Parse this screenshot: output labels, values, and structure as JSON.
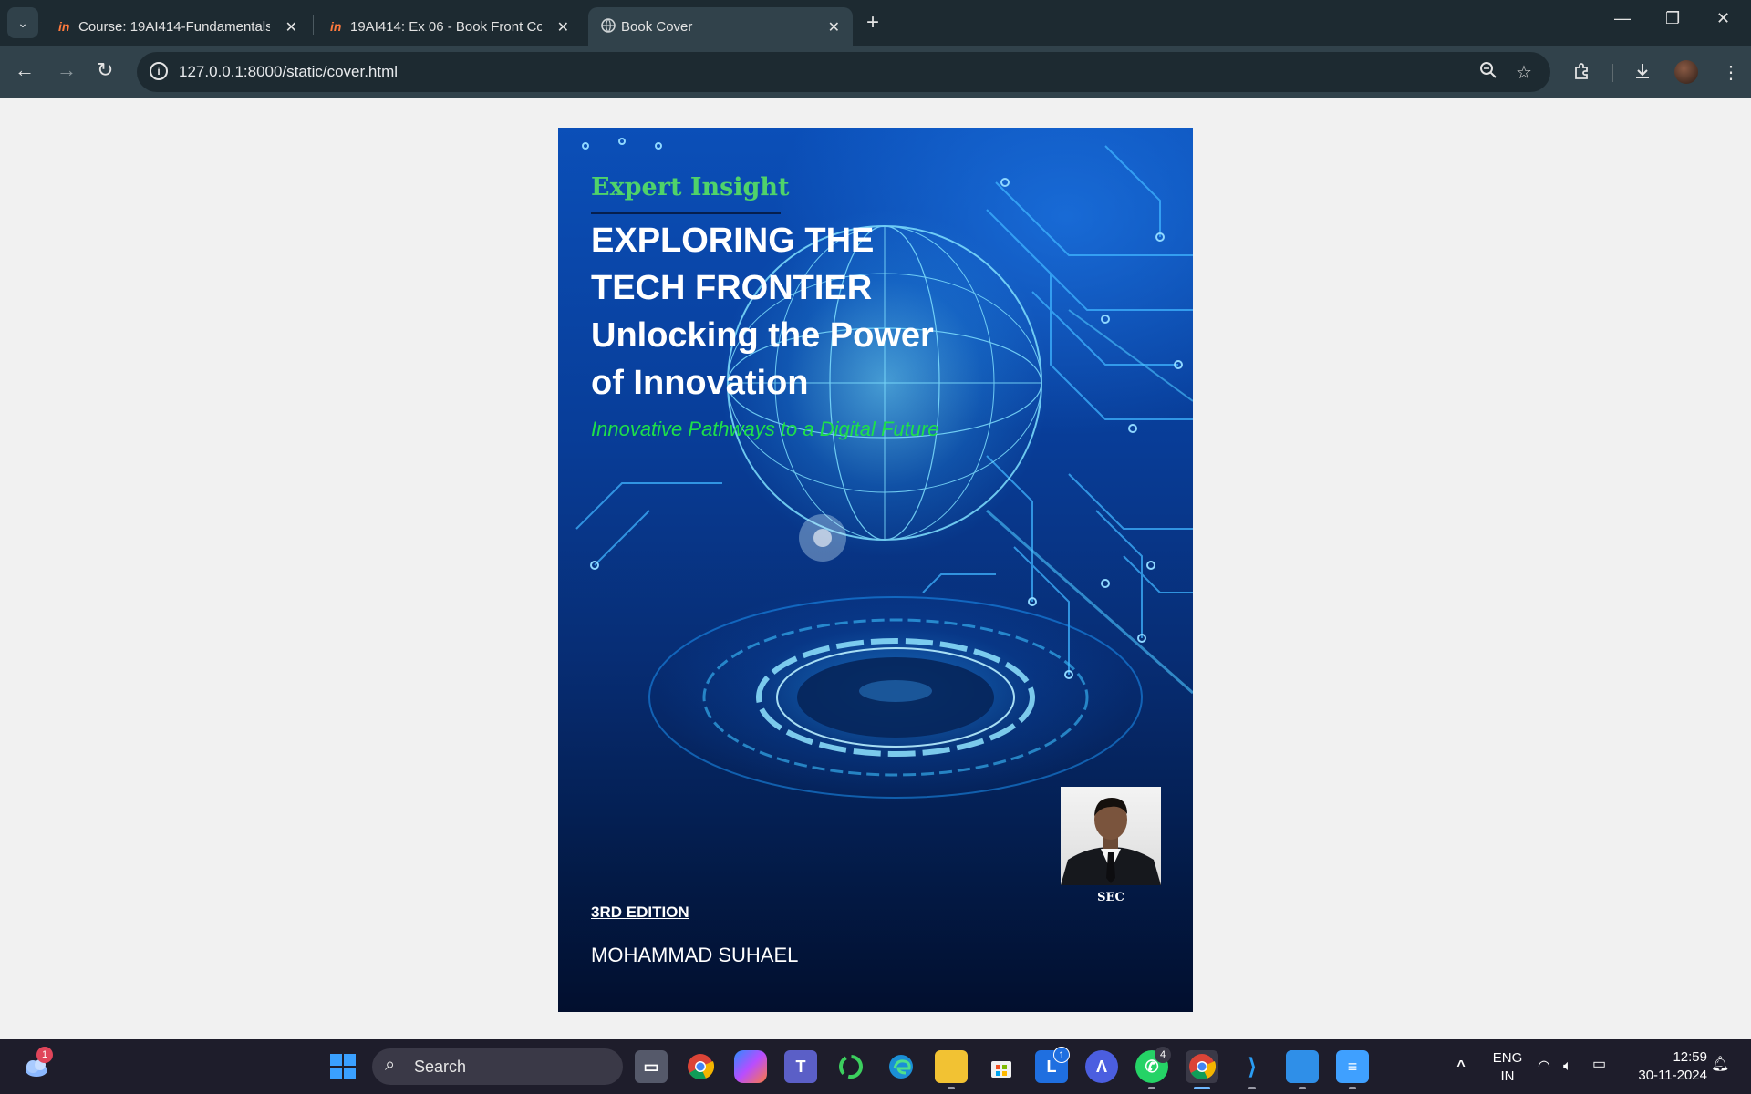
{
  "browser": {
    "tabs": [
      {
        "title": "Course: 19AI414-Fundamentals",
        "favicon": "in",
        "active": false
      },
      {
        "title": "19AI414: Ex 06 - Book Front Co",
        "favicon": "in",
        "active": false
      },
      {
        "title": "Book Cover",
        "favicon": "globe-icon",
        "active": true
      }
    ],
    "url": "127.0.0.1:8000/static/cover.html"
  },
  "cover": {
    "series": "Expert Insight",
    "title_line1": "EXPLORING THE",
    "title_line2": "TECH FRONTIER",
    "title_line3": "Unlocking the Power",
    "title_line4": "of Innovation",
    "tagline": "Innovative Pathways to a Digital Future",
    "photo_label": "SEC",
    "edition": "3RD EDITION",
    "author": "MOHAMMAD SUHAEL",
    "colors": {
      "series": "#4fd36a",
      "tagline": "#1ee04a",
      "title": "#ffffff"
    }
  },
  "taskbar": {
    "search_label": "Search",
    "widgets_badge": "1",
    "linkedin_badge": "1",
    "whatsapp_badge": "4",
    "language": "ENG",
    "region": "IN",
    "time": "12:59",
    "date": "30-11-2024"
  }
}
